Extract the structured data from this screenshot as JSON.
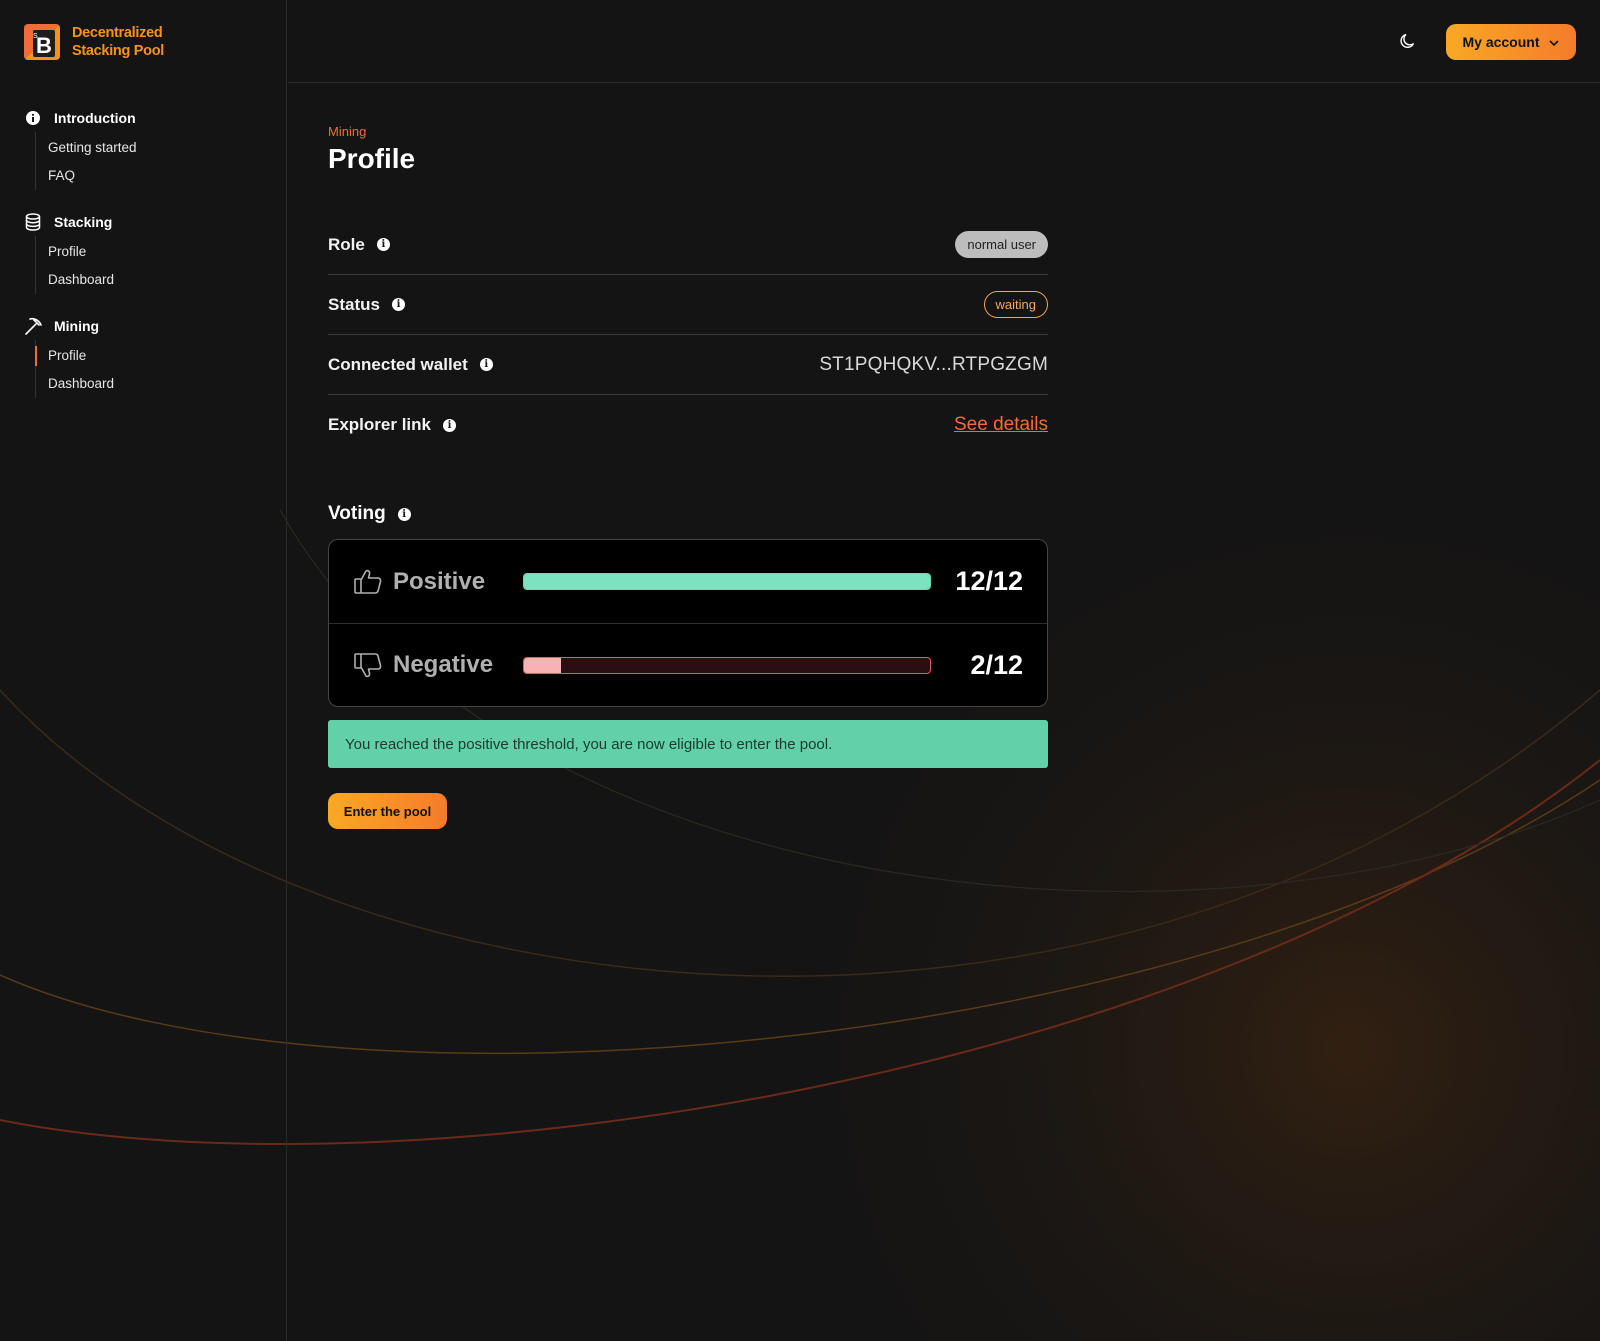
{
  "app": {
    "name_line1": "Decentralized",
    "name_line2": "Stacking Pool",
    "logo_letter": "B",
    "logo_sup": "S"
  },
  "sidebar": {
    "groups": [
      {
        "label": "Introduction",
        "icon": "info-circle-icon",
        "items": [
          {
            "label": "Getting started",
            "active": false
          },
          {
            "label": "FAQ",
            "active": false
          }
        ]
      },
      {
        "label": "Stacking",
        "icon": "database-icon",
        "items": [
          {
            "label": "Profile",
            "active": false
          },
          {
            "label": "Dashboard",
            "active": false
          }
        ]
      },
      {
        "label": "Mining",
        "icon": "pickaxe-icon",
        "items": [
          {
            "label": "Profile",
            "active": true
          },
          {
            "label": "Dashboard",
            "active": false
          }
        ]
      }
    ]
  },
  "header": {
    "theme_toggle_icon": "moon-icon",
    "account_label": "My account"
  },
  "page": {
    "breadcrumb": "Mining",
    "title": "Profile"
  },
  "profile": {
    "role_label": "Role",
    "role_value": "normal user",
    "status_label": "Status",
    "status_value": "waiting",
    "wallet_label": "Connected wallet",
    "wallet_value": "ST1PQHQKV...RTPGZGM",
    "explorer_label": "Explorer link",
    "explorer_value": "See details"
  },
  "voting": {
    "title": "Voting",
    "positive": {
      "label": "Positive",
      "count": "12/12",
      "fraction": 1.0
    },
    "negative": {
      "label": "Negative",
      "count": "2/12",
      "fraction": 0.0909
    }
  },
  "alert": {
    "text": "You reached the positive threshold, you are now eligible to enter the pool."
  },
  "cta": {
    "label": "Enter the pool"
  },
  "colors": {
    "accent": "#f26b3a",
    "brand_orange": "#f7931a",
    "positive": "#7ae3c0",
    "negative": "#f7b2b5",
    "success_bg": "#62d1aa"
  }
}
